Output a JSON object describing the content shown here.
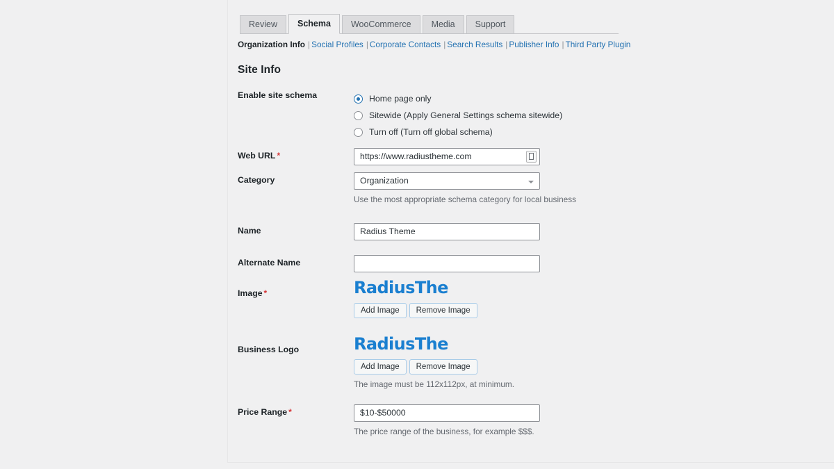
{
  "tabs": [
    {
      "label": "Review",
      "active": false
    },
    {
      "label": "Schema",
      "active": true
    },
    {
      "label": "WooCommerce",
      "active": false
    },
    {
      "label": "Media",
      "active": false
    },
    {
      "label": "Support",
      "active": false
    }
  ],
  "subnav": {
    "current": "Organization Info",
    "links": [
      "Social Profiles",
      "Corporate Contacts",
      "Search Results",
      "Publisher Info",
      "Third Party Plugin"
    ],
    "separator": "|"
  },
  "section": {
    "title": "Site Info"
  },
  "fields": {
    "enable_site_schema": {
      "label": "Enable site schema",
      "options": [
        {
          "label": "Home page only",
          "checked": true
        },
        {
          "label": "Sitewide (Apply General Settings schema sitewide)",
          "checked": false
        },
        {
          "label": "Turn off (Turn off global schema)",
          "checked": false
        }
      ]
    },
    "web_url": {
      "label": "Web URL",
      "required": true,
      "value": "https://www.radiustheme.com",
      "placeholder": "",
      "icon": "form-fill-icon"
    },
    "category": {
      "label": "Category",
      "required": false,
      "value": "Organization",
      "help": "Use the most appropriate schema category for local business",
      "caret_icon": "chevron-down-icon"
    },
    "name": {
      "label": "Name",
      "required": false,
      "value": "Radius Theme",
      "placeholder": ""
    },
    "alternate_name": {
      "label": "Alternate Name",
      "required": false,
      "value": "",
      "placeholder": ""
    },
    "image": {
      "label": "Image",
      "required": true,
      "preview_text": "RadiusThe",
      "add_label": "Add Image",
      "remove_label": "Remove Image"
    },
    "business_logo": {
      "label": "Business Logo",
      "required": false,
      "preview_text": "RadiusThe",
      "add_label": "Add Image",
      "remove_label": "Remove Image",
      "help": "The image must be 112x112px, at minimum."
    },
    "price_range": {
      "label": "Price Range",
      "required": true,
      "value": "$10-$50000",
      "help": "The price range of the business, for example $$$."
    }
  },
  "colors": {
    "accent": "#2271b1",
    "required": "#d63638",
    "logo": "#1a7fd0",
    "background": "#f0f0f1",
    "text": "#1d2327",
    "muted": "#646970"
  }
}
